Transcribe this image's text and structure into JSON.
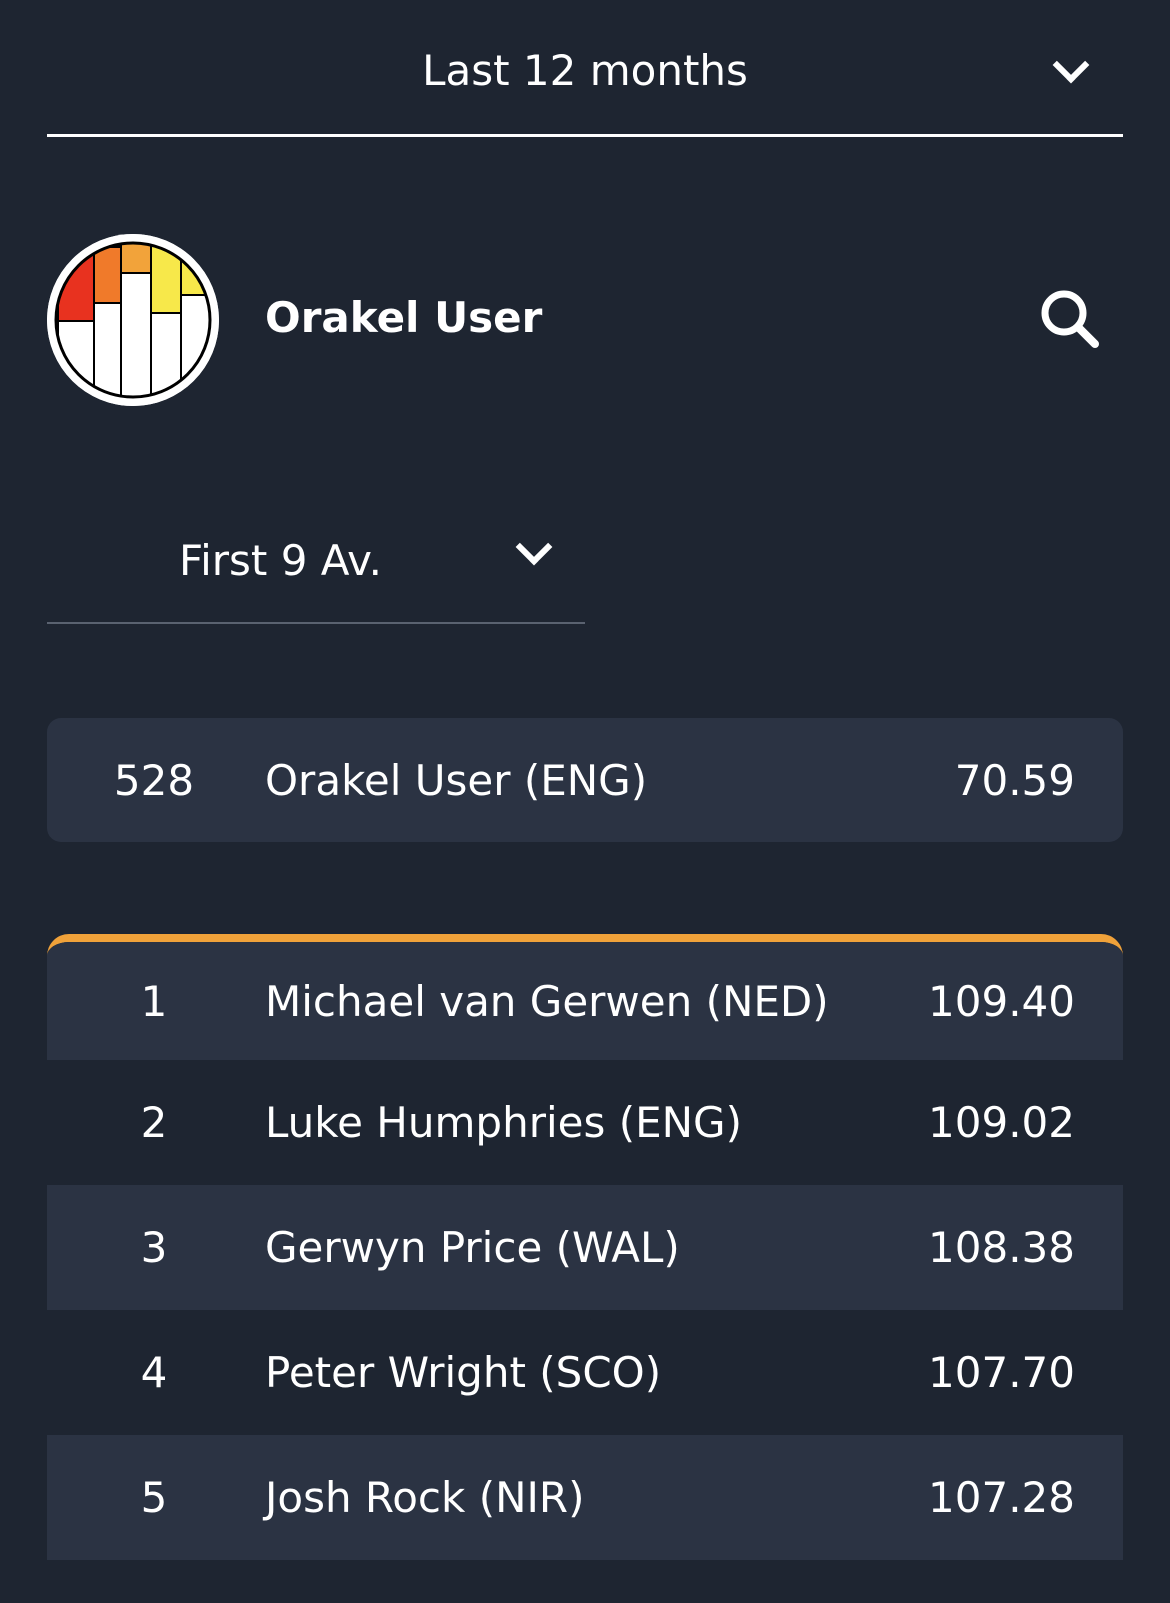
{
  "period_filter": {
    "selected": "Last 12 months"
  },
  "profile": {
    "name": "Orakel User",
    "logo_colors": [
      "#e8321f",
      "#f07a2a",
      "#f2a33a",
      "#f7e84a"
    ]
  },
  "stat_filter": {
    "selected": "First 9 Av."
  },
  "user_row": {
    "rank": "528",
    "name": "Orakel User (ENG)",
    "value": "70.59"
  },
  "leaderboard": {
    "accent_color": "#f0a23a",
    "rows": [
      {
        "rank": "1",
        "name": "Michael van Gerwen (NED)",
        "value": "109.40"
      },
      {
        "rank": "2",
        "name": "Luke Humphries (ENG)",
        "value": "109.02"
      },
      {
        "rank": "3",
        "name": "Gerwyn Price (WAL)",
        "value": "108.38"
      },
      {
        "rank": "4",
        "name": "Peter Wright (SCO)",
        "value": "107.70"
      },
      {
        "rank": "5",
        "name": "Josh Rock (NIR)",
        "value": "107.28"
      }
    ]
  }
}
